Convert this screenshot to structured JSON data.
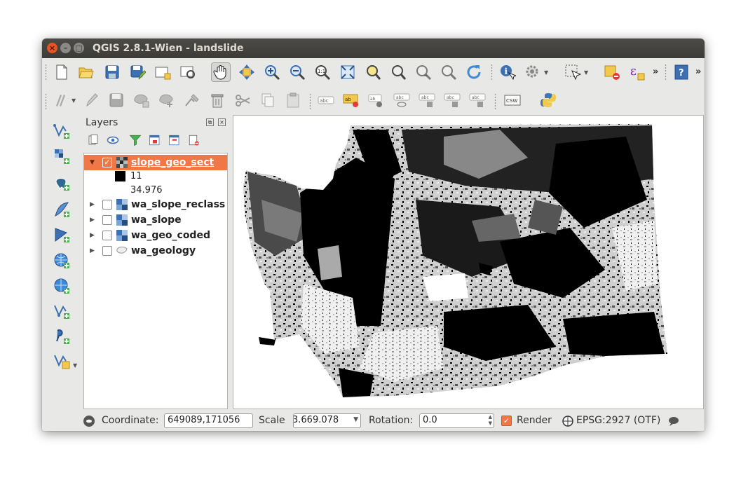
{
  "window": {
    "title": "QGIS 2.8.1-Wien - landslide",
    "close_symbol": "×",
    "minimize_symbol": "–",
    "maximize_symbol": "□"
  },
  "toolbar_top": {
    "icons": [
      "new-project-icon",
      "open-project-icon",
      "save-project-icon",
      "save-as-icon",
      "new-print-composer-icon",
      "composer-manager-icon",
      "pan-icon",
      "pan-to-selection-icon",
      "zoom-in-icon",
      "zoom-out-icon",
      "zoom-native-icon",
      "zoom-full-icon",
      "zoom-to-selection-icon",
      "zoom-to-layer-icon",
      "zoom-last-icon",
      "zoom-next-icon",
      "refresh-icon",
      "identify-icon",
      "action-icon",
      "select-icon",
      "deselect-icon",
      "expression-icon",
      "help-icon"
    ],
    "overflow": "»"
  },
  "toolbar_edit": {
    "icons": [
      "current-edits-icon",
      "toggle-editing-icon",
      "save-edits-icon",
      "add-feature-icon",
      "move-feature-icon",
      "node-tool-icon",
      "delete-selected-icon",
      "cut-icon",
      "copy-icon",
      "paste-icon",
      "label-icon",
      "layer-labeling-icon",
      "pin-labels-icon",
      "show-hide-labels-icon",
      "move-label-icon",
      "rotate-label-icon",
      "change-label-icon",
      "csw-icon",
      "python-console-icon"
    ],
    "csw_label": "CSW"
  },
  "left_toolbar": {
    "icons": [
      "add-vector-layer-icon",
      "add-raster-layer-icon",
      "add-postgis-layer-icon",
      "add-spatialite-layer-icon",
      "add-mssql-layer-icon",
      "add-wms-layer-icon",
      "add-wcs-layer-icon",
      "add-wfs-layer-icon",
      "add-delimited-text-icon",
      "new-shapefile-icon"
    ]
  },
  "layers_panel": {
    "title": "Layers",
    "float_symbol": "⧉",
    "close_symbol": "×",
    "toolbar_icons": [
      "add-group-icon",
      "manage-visibility-icon",
      "filter-legend-icon",
      "expand-all-icon",
      "collapse-all-icon",
      "remove-layer-icon"
    ],
    "layers": [
      {
        "name": "slope_geo_sect",
        "checked": true,
        "expanded": true,
        "selected": true,
        "type": "raster"
      },
      {
        "name": "wa_slope_reclass",
        "checked": false,
        "expanded": false,
        "selected": false,
        "type": "raster"
      },
      {
        "name": "wa_slope",
        "checked": false,
        "expanded": false,
        "selected": false,
        "type": "raster"
      },
      {
        "name": "wa_geo_coded",
        "checked": false,
        "expanded": false,
        "selected": false,
        "type": "raster"
      },
      {
        "name": "wa_geology",
        "checked": false,
        "expanded": false,
        "selected": false,
        "type": "vector"
      }
    ],
    "legend": {
      "max": "11",
      "min": "34.976"
    },
    "check_mark": "✓",
    "arrow_expanded": "▼",
    "arrow_collapsed": "▶"
  },
  "statusbar": {
    "coordinate_label": "Coordinate:",
    "coordinate_value": "649089,171056",
    "scale_label": "Scale",
    "scale_value": "3.669.078",
    "rotation_label": "Rotation:",
    "rotation_value": "0.0",
    "render_label": "Render",
    "render_checked": true,
    "crs_label": "EPSG:2927 (OTF)"
  },
  "colors": {
    "selection": "#f07746",
    "window_bg": "#e8e8e7",
    "titlebar": "#3c3b37"
  }
}
